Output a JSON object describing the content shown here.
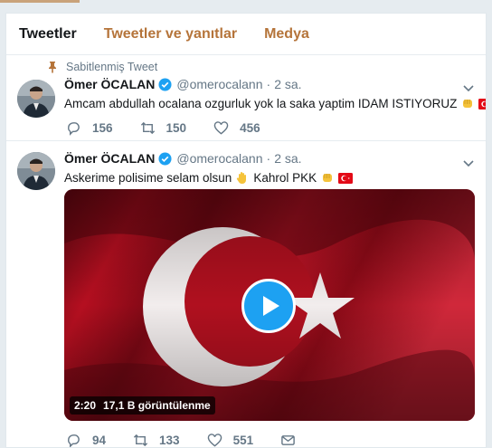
{
  "tabs": [
    {
      "label": "Tweetler"
    },
    {
      "label": "Tweetler ve yanıtlar"
    },
    {
      "label": "Medya"
    }
  ],
  "colors": {
    "accent": "#b5743a",
    "verified": "#1da1f2",
    "muted": "#657786",
    "flag_red": "#c8102e"
  },
  "tweets": [
    {
      "pinned_label": "Sabitlenmiş Tweet",
      "name": "Ömer ÖCALAN",
      "handle": "@omerocalann",
      "dot": "·",
      "time": "2 sa.",
      "text": "Amcam abdullah ocalana ozgurluk yok la saka yaptim IDAM ISTIYORUZ",
      "emojis": [
        "fist-emoji",
        "turkey-flag-emoji"
      ],
      "replies": "156",
      "retweets": "150",
      "likes": "456"
    },
    {
      "name": "Ömer ÖCALAN",
      "handle": "@omerocalann",
      "dot": "·",
      "time": "2 sa.",
      "text": "Askerime polisime selam olsun",
      "text_after": "Kahrol PKK",
      "emojis": [
        "raised-hand-emoji",
        "fist-emoji",
        "turkey-flag-emoji"
      ],
      "video": {
        "duration": "2:20",
        "views": "17,1 B görüntülenme"
      },
      "replies": "94",
      "retweets": "133",
      "likes": "551"
    }
  ]
}
